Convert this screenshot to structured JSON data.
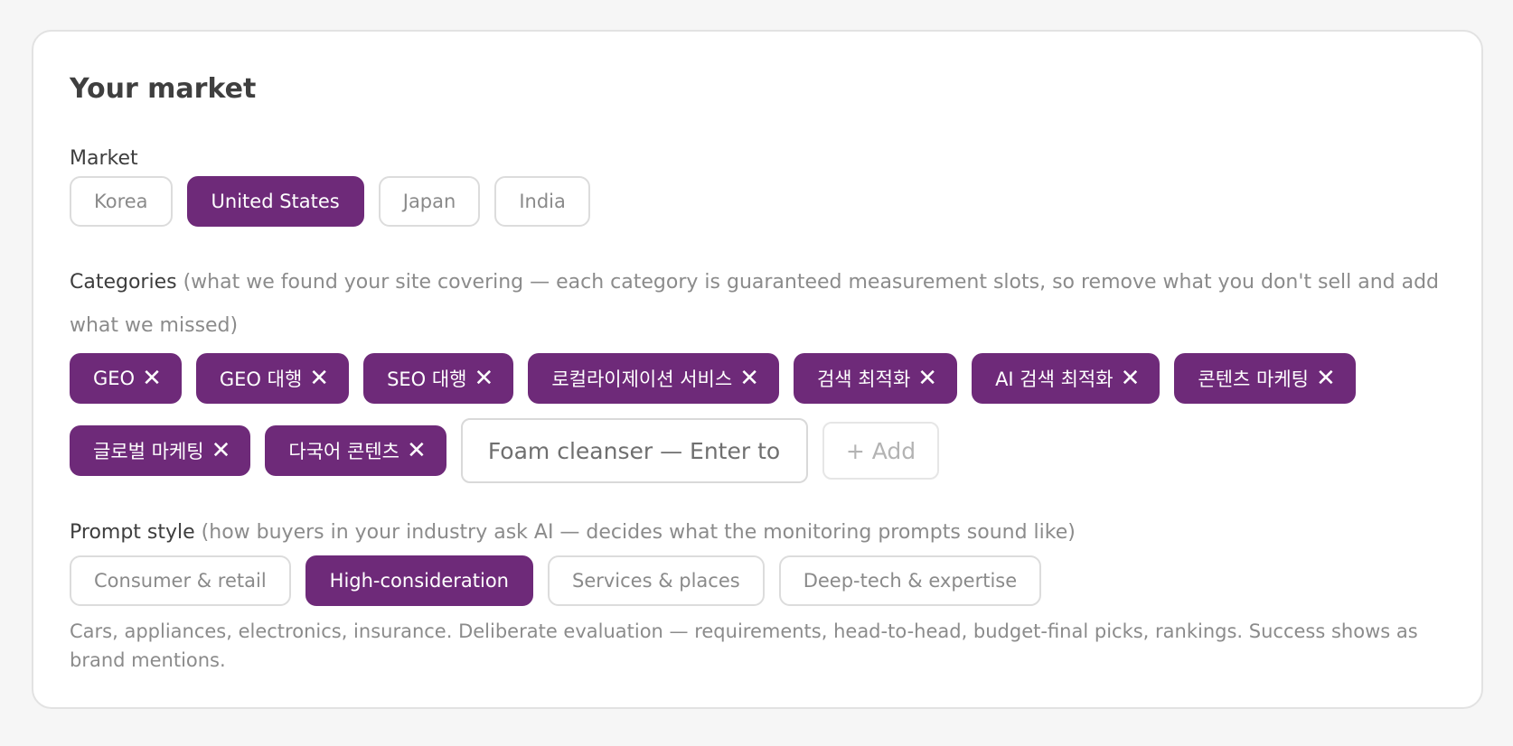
{
  "card": {
    "title": "Your market"
  },
  "market": {
    "label": "Market",
    "options": [
      {
        "label": "Korea",
        "selected": false
      },
      {
        "label": "United States",
        "selected": true
      },
      {
        "label": "Japan",
        "selected": false
      },
      {
        "label": "India",
        "selected": false
      }
    ]
  },
  "categories": {
    "label": "Categories",
    "hint": "(what we found your site covering — each category is guaranteed measurement slots, so remove what you don't sell and add what we missed)",
    "tags": [
      "GEO",
      "GEO 대행",
      "SEO 대행",
      "로컬라이제이션 서비스",
      "검색 최적화",
      "AI 검색 최적화",
      "콘텐츠 마케팅",
      "글로벌 마케팅",
      "다국어 콘텐츠"
    ],
    "remove_glyph": "✕",
    "input_placeholder": "Foam cleanser — Enter to",
    "add_label": "+ Add"
  },
  "prompt_style": {
    "label": "Prompt style",
    "hint": "(how buyers in your industry ask AI — decides what the monitoring prompts sound like)",
    "options": [
      {
        "label": "Consumer & retail",
        "selected": false
      },
      {
        "label": "High-consideration",
        "selected": true
      },
      {
        "label": "Services & places",
        "selected": false
      },
      {
        "label": "Deep-tech & expertise",
        "selected": false
      }
    ],
    "description": "Cars, appliances, electronics, insurance. Deliberate evaluation — requirements, head-to-head, budget-final picks, rankings. Success shows as brand mentions."
  },
  "colors": {
    "accent": "#6e2a79",
    "border": "#dcdcdc",
    "muted_text": "#8b8b8b"
  }
}
